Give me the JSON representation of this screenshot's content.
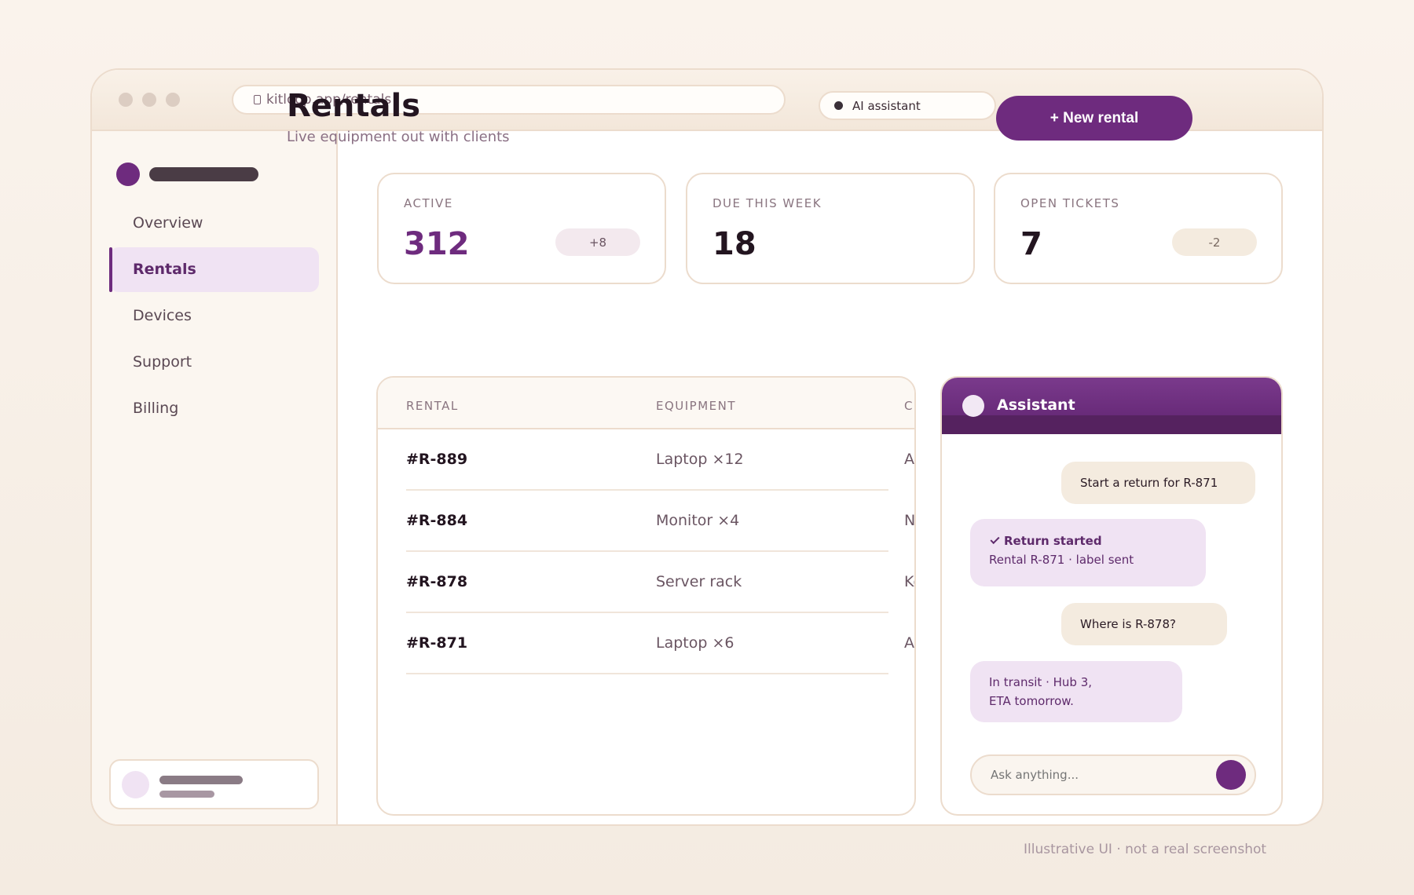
{
  "browser": {
    "url": "kitloop.app/rentals",
    "ai_pill_label": "AI assistant"
  },
  "sidebar": {
    "items": [
      {
        "label": "Overview",
        "active": false
      },
      {
        "label": "Rentals",
        "active": true
      },
      {
        "label": "Devices",
        "active": false
      },
      {
        "label": "Support",
        "active": false
      },
      {
        "label": "Billing",
        "active": false
      }
    ]
  },
  "header": {
    "title": "Rentals",
    "subtitle": "Live equipment out with clients",
    "new_button": "+ New rental"
  },
  "stats": [
    {
      "label": "ACTIVE",
      "value": "312",
      "badge": "+8"
    },
    {
      "label": "DUE THIS WEEK",
      "value": "18",
      "badge": ""
    },
    {
      "label": "OPEN TICKETS",
      "value": "7",
      "badge": "-2"
    }
  ],
  "table": {
    "columns": [
      "RENTAL",
      "EQUIPMENT",
      "CLIEN"
    ],
    "rows": [
      {
        "id": "#R-889",
        "equipment": "Laptop ×12",
        "client": "Acme"
      },
      {
        "id": "#R-884",
        "equipment": "Monitor ×4",
        "client": "Nadir"
      },
      {
        "id": "#R-878",
        "equipment": "Server rack",
        "client": "Kestr"
      },
      {
        "id": "#R-871",
        "equipment": "Laptop ×6",
        "client": "Acme"
      }
    ]
  },
  "assistant": {
    "title": "Assistant",
    "messages": [
      {
        "from": "user",
        "text": "Start a return for R-871"
      },
      {
        "from": "bot",
        "title": "Return started",
        "text": "Rental R-871 · label sent"
      },
      {
        "from": "user",
        "text": "Where is R-878?"
      },
      {
        "from": "bot",
        "line1": "In transit · Hub 3,",
        "line2": "ETA tomorrow."
      }
    ],
    "input_placeholder": "Ask anything..."
  },
  "footnote": "Illustrative UI · not a real screenshot",
  "colors": {
    "accent": "#6e2b7e",
    "accent_soft": "#f0e3f3",
    "border": "#ecdccd"
  }
}
